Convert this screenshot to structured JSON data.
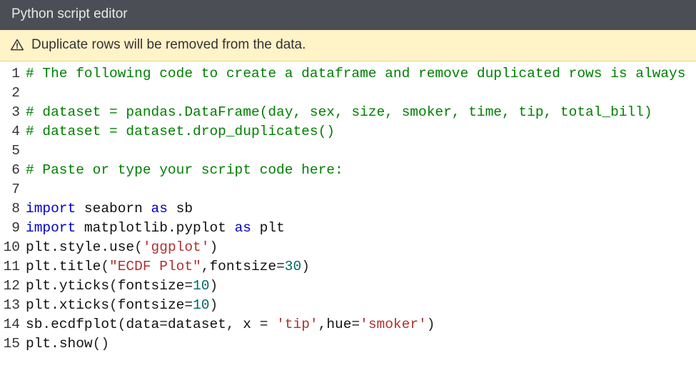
{
  "header": {
    "title": "Python script editor"
  },
  "warning": {
    "icon_name": "warning-triangle-icon",
    "message": "Duplicate rows will be removed from the data."
  },
  "gutter": {
    "lines": [
      "1",
      "2",
      "3",
      "4",
      "5",
      "6",
      "7",
      "8",
      "9",
      "10",
      "11",
      "12",
      "13",
      "14",
      "15"
    ]
  },
  "code": {
    "lines": [
      [
        {
          "cls": "c-comment",
          "t": "# The following code to create a dataframe and remove duplicated rows is always"
        }
      ],
      [],
      [
        {
          "cls": "c-comment",
          "t": "# dataset = pandas.DataFrame(day, sex, size, smoker, time, tip, total_bill)"
        }
      ],
      [
        {
          "cls": "c-comment",
          "t": "# dataset = dataset.drop_duplicates()"
        }
      ],
      [],
      [
        {
          "cls": "c-comment",
          "t": "# Paste or type your script code here:"
        }
      ],
      [],
      [
        {
          "cls": "c-keyword",
          "t": "import"
        },
        {
          "cls": "c-ident",
          "t": " seaborn "
        },
        {
          "cls": "c-keyword",
          "t": "as"
        },
        {
          "cls": "c-ident",
          "t": " sb"
        }
      ],
      [
        {
          "cls": "c-keyword",
          "t": "import"
        },
        {
          "cls": "c-ident",
          "t": " matplotlib"
        },
        {
          "cls": "c-punct",
          "t": "."
        },
        {
          "cls": "c-ident",
          "t": "pyplot "
        },
        {
          "cls": "c-keyword",
          "t": "as"
        },
        {
          "cls": "c-ident",
          "t": " plt"
        }
      ],
      [
        {
          "cls": "c-ident",
          "t": "plt"
        },
        {
          "cls": "c-punct",
          "t": "."
        },
        {
          "cls": "c-ident",
          "t": "style"
        },
        {
          "cls": "c-punct",
          "t": "."
        },
        {
          "cls": "c-ident",
          "t": "use"
        },
        {
          "cls": "c-punct",
          "t": "("
        },
        {
          "cls": "c-string",
          "t": "'ggplot'"
        },
        {
          "cls": "c-punct",
          "t": ")"
        }
      ],
      [
        {
          "cls": "c-ident",
          "t": "plt"
        },
        {
          "cls": "c-punct",
          "t": "."
        },
        {
          "cls": "c-ident",
          "t": "title"
        },
        {
          "cls": "c-punct",
          "t": "("
        },
        {
          "cls": "c-string",
          "t": "\"ECDF Plot\""
        },
        {
          "cls": "c-punct",
          "t": ","
        },
        {
          "cls": "c-ident",
          "t": "fontsize"
        },
        {
          "cls": "c-punct",
          "t": "="
        },
        {
          "cls": "c-num",
          "t": "30"
        },
        {
          "cls": "c-punct",
          "t": ")"
        }
      ],
      [
        {
          "cls": "c-ident",
          "t": "plt"
        },
        {
          "cls": "c-punct",
          "t": "."
        },
        {
          "cls": "c-ident",
          "t": "yticks"
        },
        {
          "cls": "c-punct",
          "t": "("
        },
        {
          "cls": "c-ident",
          "t": "fontsize"
        },
        {
          "cls": "c-punct",
          "t": "="
        },
        {
          "cls": "c-num",
          "t": "10"
        },
        {
          "cls": "c-punct",
          "t": ")"
        }
      ],
      [
        {
          "cls": "c-ident",
          "t": "plt"
        },
        {
          "cls": "c-punct",
          "t": "."
        },
        {
          "cls": "c-ident",
          "t": "xticks"
        },
        {
          "cls": "c-punct",
          "t": "("
        },
        {
          "cls": "c-ident",
          "t": "fontsize"
        },
        {
          "cls": "c-punct",
          "t": "="
        },
        {
          "cls": "c-num",
          "t": "10"
        },
        {
          "cls": "c-punct",
          "t": ")"
        }
      ],
      [
        {
          "cls": "c-ident",
          "t": "sb"
        },
        {
          "cls": "c-punct",
          "t": "."
        },
        {
          "cls": "c-ident",
          "t": "ecdfplot"
        },
        {
          "cls": "c-punct",
          "t": "("
        },
        {
          "cls": "c-ident",
          "t": "data"
        },
        {
          "cls": "c-punct",
          "t": "="
        },
        {
          "cls": "c-ident",
          "t": "dataset"
        },
        {
          "cls": "c-punct",
          "t": ", "
        },
        {
          "cls": "c-ident",
          "t": "x "
        },
        {
          "cls": "c-punct",
          "t": "= "
        },
        {
          "cls": "c-string",
          "t": "'tip'"
        },
        {
          "cls": "c-punct",
          "t": ","
        },
        {
          "cls": "c-ident",
          "t": "hue"
        },
        {
          "cls": "c-punct",
          "t": "="
        },
        {
          "cls": "c-string",
          "t": "'smoker'"
        },
        {
          "cls": "c-punct",
          "t": ")"
        }
      ],
      [
        {
          "cls": "c-ident",
          "t": "plt"
        },
        {
          "cls": "c-punct",
          "t": "."
        },
        {
          "cls": "c-ident",
          "t": "show"
        },
        {
          "cls": "c-punct",
          "t": "()"
        }
      ]
    ]
  }
}
